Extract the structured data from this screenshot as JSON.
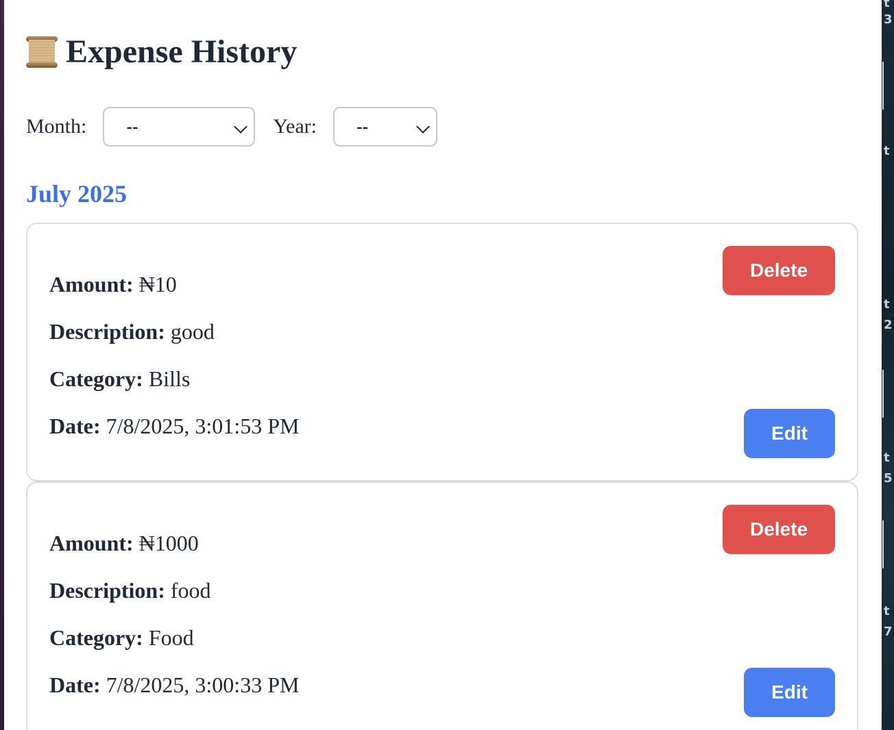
{
  "page": {
    "title_icon": "scroll-icon",
    "title": "Expense History"
  },
  "filters": {
    "month_label": "Month:",
    "month_value": "--",
    "year_label": "Year:",
    "year_value": "--"
  },
  "groups": [
    {
      "heading": "July 2025",
      "expenses": [
        {
          "amount_label": "Amount:",
          "amount": "₦10",
          "description_label": "Description:",
          "description": "good",
          "category_label": "Category:",
          "category": "Bills",
          "date_label": "Date:",
          "date": "7/8/2025, 3:01:53 PM",
          "delete_label": "Delete",
          "edit_label": "Edit"
        },
        {
          "amount_label": "Amount:",
          "amount": "₦1000",
          "description_label": "Description:",
          "description": "food",
          "category_label": "Category:",
          "category": "Food",
          "date_label": "Date:",
          "date": "7/8/2025, 3:00:33 PM",
          "delete_label": "Delete",
          "edit_label": "Edit"
        }
      ]
    }
  ],
  "colors": {
    "heading_blue": "#3c6fe0",
    "delete_red": "#e0514e",
    "edit_blue": "#4b7ff0",
    "text": "#1f2937"
  }
}
